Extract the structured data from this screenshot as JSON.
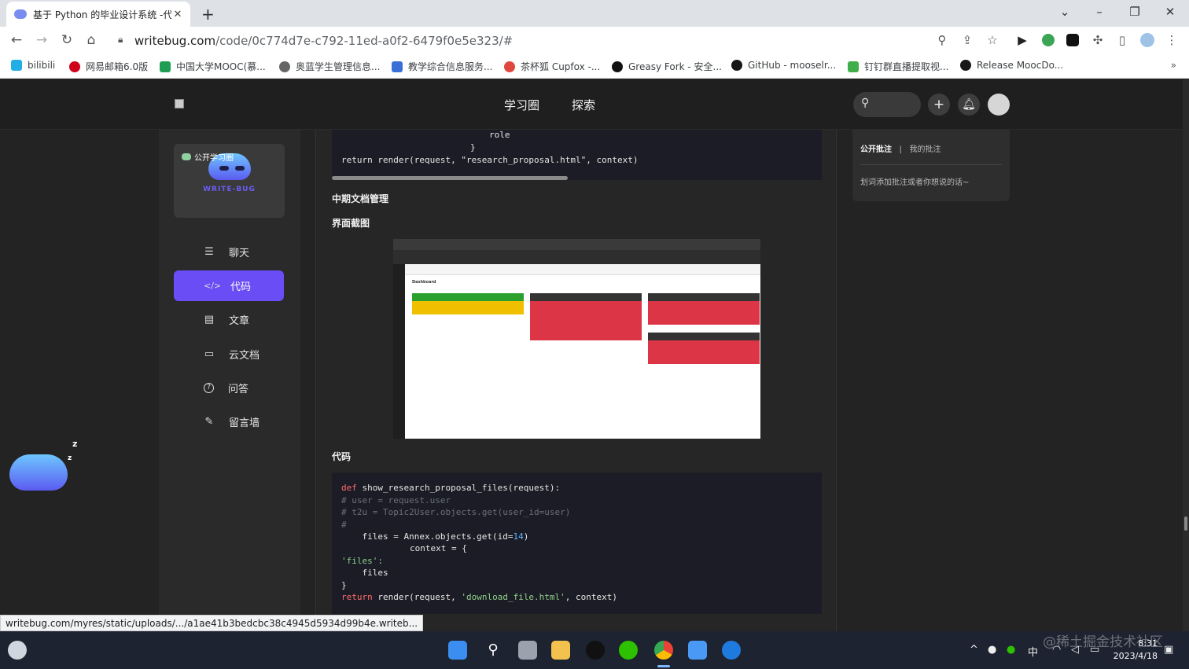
{
  "browser": {
    "tab_title": "基于 Python 的毕业设计系统 -代",
    "tab_close": "✕",
    "new_tab": "+",
    "url_host": "writebug.com",
    "url_path": "/code/0c774d7e-c792-11ed-a0f2-6479f0e5e323/#",
    "bookmarks": [
      {
        "label": "bilibili",
        "color": "#23ade5"
      },
      {
        "label": "网易邮箱6.0版",
        "color": "#d0021b"
      },
      {
        "label": "中国大学MOOC(慕...",
        "color": "#1f9d55"
      },
      {
        "label": "奥蓝学生管理信息...",
        "color": "#666666"
      },
      {
        "label": "教学综合信息服务...",
        "color": "#3a6fd8"
      },
      {
        "label": "茶杯狐 Cupfox -...",
        "color": "#e0483e"
      },
      {
        "label": "Greasy Fork - 安全...",
        "color": "#111111"
      },
      {
        "label": "GitHub - mooselr...",
        "color": "#181717"
      },
      {
        "label": "钉钉群直播提取视...",
        "color": "#3fae49"
      },
      {
        "label": "Release MoocDo...",
        "color": "#181717"
      }
    ],
    "bookmarks_more": "»",
    "status_url": "writebug.com/myres/static/uploads/.../a1ae41b3bedcbc38c4945d5934d99b4e.writeb..."
  },
  "site": {
    "nav": [
      "学习圈",
      "探索"
    ],
    "brand_tag": "公开学习圈",
    "brand_name": "WRITE-BUG",
    "menu": [
      {
        "icon": "chat-icon",
        "glyph": "☰",
        "label": "聊天"
      },
      {
        "icon": "code-icon",
        "glyph": "</>",
        "label": "代码"
      },
      {
        "icon": "article-icon",
        "glyph": "▤",
        "label": "文章"
      },
      {
        "icon": "folder-icon",
        "glyph": "▭",
        "label": "云文档"
      },
      {
        "icon": "question-icon",
        "glyph": "?",
        "label": "问答"
      },
      {
        "icon": "edit-icon",
        "glyph": "✎",
        "label": "留言墙"
      }
    ],
    "active_menu": "代码"
  },
  "article": {
    "code_top": [
      "role",
      "}",
      "return render(request, \"research_proposal.html\", context)"
    ],
    "section_mid": "中期文档管理",
    "section_shot": "界面截图",
    "section_code": "代码",
    "embedded_shot": {
      "title": "Dashboard",
      "columns": [
        {
          "header_color": "#2ca02c",
          "block_color": "#f0c000",
          "block_rows": 1
        },
        {
          "header_color": "#333333",
          "block_color": "#dc3545",
          "block_rows": 3
        },
        {
          "header_color": "#333333",
          "block_color": "#dc3545",
          "block_rows": 2
        }
      ]
    },
    "code_bottom": {
      "l1_kw": "def",
      "l1_rest": " show_research_proposal_files(request):",
      "l2": "# user = request.user",
      "l3": "# t2u = Topic2User.objects.get(user_id=user)",
      "l4": "#",
      "l5_a": "    files = Annex.objects.get(id=",
      "l5_num": "14",
      "l5_b": ")",
      "l6": "        context = {",
      "l7": "'files':",
      "l8": "    files",
      "l9": "}",
      "l10_kw": "return",
      "l10_a": " render(request, ",
      "l10_str": "'download_file.html'",
      "l10_b": ", context)"
    }
  },
  "annotations": {
    "tab_public": "公开批注",
    "separator": "|",
    "tab_mine": "我的批注",
    "hint": "划词添加批注或者你想说的话~"
  },
  "taskbar": {
    "tray_lang": "中",
    "time": "8:31",
    "date": "2023/4/18"
  },
  "watermark": "@稀土掘金技术社区"
}
